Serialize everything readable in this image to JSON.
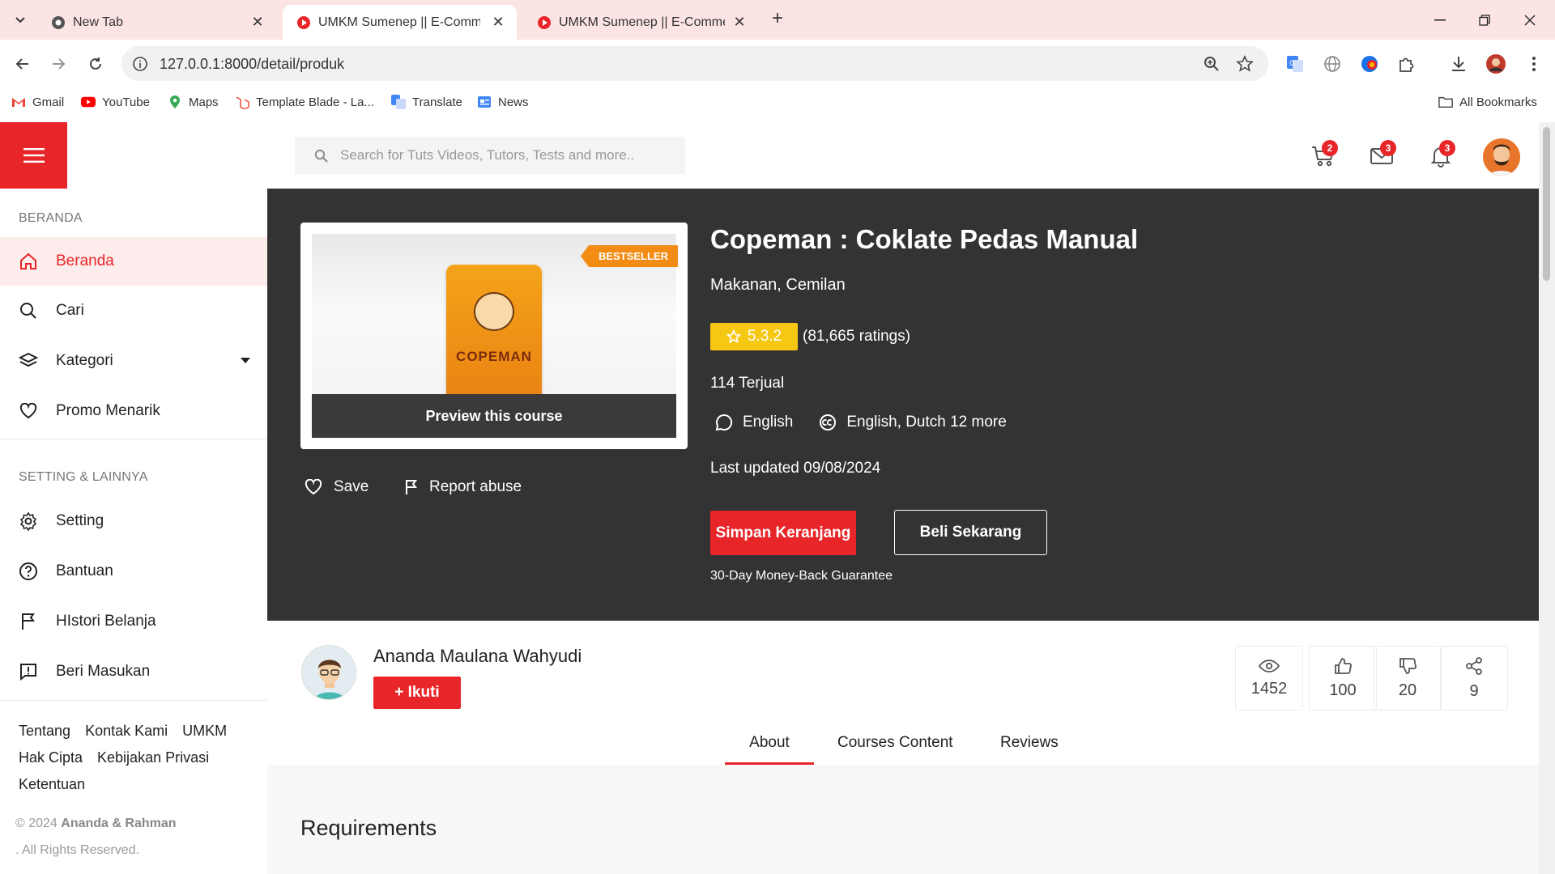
{
  "browser": {
    "tabs": [
      {
        "title": "New Tab",
        "active": false
      },
      {
        "title": "UMKM Sumenep || E-Commerce",
        "active": true
      },
      {
        "title": "UMKM Sumenep || E-Commerce",
        "active": false
      }
    ],
    "url": "127.0.0.1:8000/detail/produk",
    "bookmarks": [
      "Gmail",
      "YouTube",
      "Maps",
      "Template Blade - La...",
      "Translate",
      "News"
    ],
    "all_bookmarks": "All Bookmarks"
  },
  "header": {
    "search_placeholder": "Search for Tuts Videos, Tutors, Tests and more..",
    "cart_count": "2",
    "mail_count": "3",
    "notif_count": "3"
  },
  "sidebar": {
    "section_main": "BERANDA",
    "items": [
      {
        "label": "Beranda",
        "icon": "home-icon",
        "active": true
      },
      {
        "label": "Cari",
        "icon": "search-icon"
      },
      {
        "label": "Kategori",
        "icon": "layers-icon"
      },
      {
        "label": "Promo Menarik",
        "icon": "heart-icon"
      }
    ],
    "section_settings": "SETTING & LAINNYA",
    "settings": [
      {
        "label": "Setting",
        "icon": "gear-icon"
      },
      {
        "label": "Bantuan",
        "icon": "help-icon"
      },
      {
        "label": "HIstori Belanja",
        "icon": "flag-icon"
      },
      {
        "label": "Beri Masukan",
        "icon": "feedback-icon"
      }
    ],
    "footer_links": [
      "Tentang",
      "Kontak Kami",
      "UMKM",
      "Hak Cipta",
      "Kebijakan Privasi",
      "Ketentuan"
    ],
    "copyright_prefix": "© 2024",
    "copyright_owner": "Ananda & Rahman",
    "rights": ". All Rights Reserved."
  },
  "product": {
    "ribbon": "BESTSELLER",
    "preview_label": "Preview this course",
    "pack_brand": "COPEMAN",
    "save_label": "Save",
    "report_label": "Report abuse",
    "title": "Copeman : Coklate Pedas Manual",
    "categories": "Makanan, Cemilan",
    "rating": "5.3.2",
    "ratings_count": "(81,665 ratings)",
    "sold": "114 Terjual",
    "language": "English",
    "captions": "English, Dutch 12 more",
    "last_updated": "Last updated 09/08/2024",
    "cart_button": "Simpan Keranjang",
    "buy_button": "Beli Sekarang",
    "guarantee": "30-Day Money-Back Guarantee"
  },
  "author": {
    "name": "Ananda Maulana Wahyudi",
    "follow_label": "+ Ikuti"
  },
  "stats": {
    "views": "1452",
    "likes": "100",
    "dislikes": "20",
    "shares": "9"
  },
  "content_tabs": [
    "About",
    "Courses Content",
    "Reviews"
  ],
  "section_heading": "Requirements",
  "colors": {
    "accent": "#e8262a",
    "hero_bg": "#333333",
    "rating": "#f6c814",
    "ribbon": "#f28c14"
  }
}
